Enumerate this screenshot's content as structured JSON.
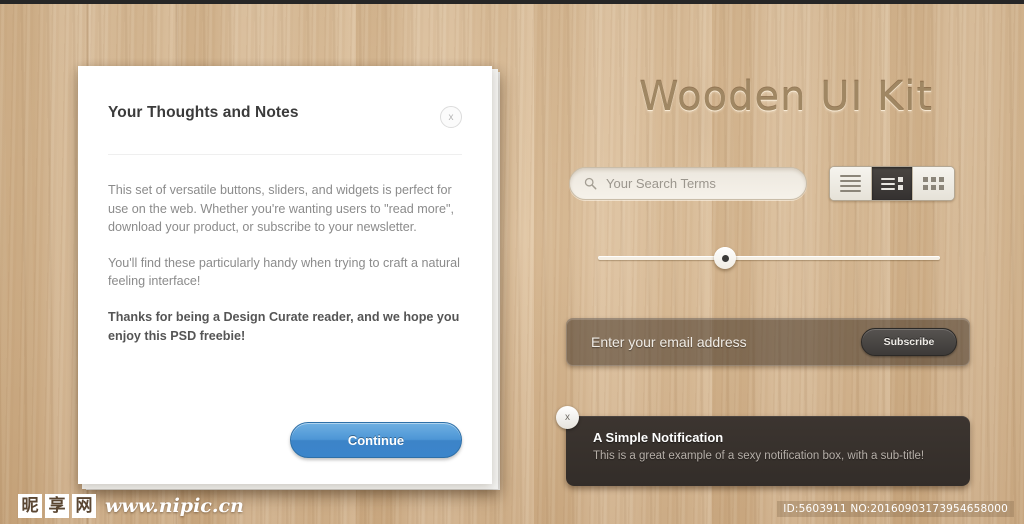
{
  "page": {
    "background": "wood-texture",
    "wood_color": "#d8bb96",
    "top_edge_color": "#262626"
  },
  "modal": {
    "title": "Your Thoughts and Notes",
    "close_icon": "x",
    "paragraphs": [
      "This set of versatile buttons, sliders, and widgets is perfect for use on the web. Whether you're wanting users to \"read more\", download your product, or subscribe to your newsletter.",
      "You'll find these particularly handy when trying to craft a natural feeling interface!"
    ],
    "emphasis": "Thanks for being a Design Curate reader, and we hope you enjoy this PSD freebie!",
    "continue_label": "Continue",
    "continue_color": "#4d96d6"
  },
  "kit": {
    "title": "Wooden UI Kit",
    "title_color": "#a08763"
  },
  "search": {
    "placeholder": "Your Search Terms",
    "icon": "search-icon"
  },
  "view_toggle": {
    "options": [
      {
        "name": "list-view",
        "icon": "list-lines-icon",
        "active": false
      },
      {
        "name": "detail-view",
        "icon": "list-detail-icon",
        "active": true
      },
      {
        "name": "grid-view",
        "icon": "grid-icon",
        "active": false
      }
    ],
    "active_color": "#3a3633"
  },
  "slider": {
    "value": 35,
    "min": 0,
    "max": 100,
    "track_color": "#f5efe4",
    "knob_color": "#ffffff"
  },
  "subscribe": {
    "placeholder": "Enter your email address",
    "button_label": "Subscribe"
  },
  "notification": {
    "title": "A Simple Notification",
    "subtitle": "This is a great example of a sexy notification box, with a sub-title!",
    "close_icon": "x",
    "background": "#3c3530"
  },
  "watermark": {
    "cjk": [
      "昵",
      "享",
      "网"
    ],
    "url": "www.nipic.cn",
    "id_line": "ID:5603911 NO:20160903173954658000"
  }
}
